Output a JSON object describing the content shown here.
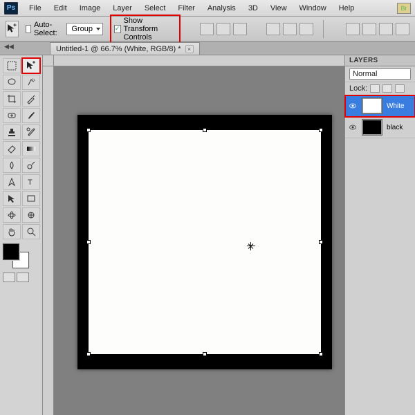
{
  "app": {
    "logo": "Ps"
  },
  "menu": [
    "File",
    "Edit",
    "Image",
    "Layer",
    "Select",
    "Filter",
    "Analysis",
    "3D",
    "View",
    "Window",
    "Help"
  ],
  "options": {
    "auto_select_label": "Auto-Select:",
    "auto_select_checked": false,
    "group_dropdown": "Group",
    "show_transform_label": "Show Transform Controls",
    "show_transform_checked": true
  },
  "document": {
    "tab_title": "Untitled-1 @ 66.7% (White, RGB/8) *"
  },
  "layers_panel": {
    "title": "LAYERS",
    "blend_mode": "Normal",
    "lock_label": "Lock:",
    "layers": [
      {
        "name": "White",
        "visible": true,
        "selected": true,
        "thumb": "white"
      },
      {
        "name": "black",
        "visible": true,
        "selected": false,
        "thumb": "black"
      }
    ]
  },
  "colors": {
    "highlight": "#e00000",
    "selection": "#3a7de0"
  }
}
